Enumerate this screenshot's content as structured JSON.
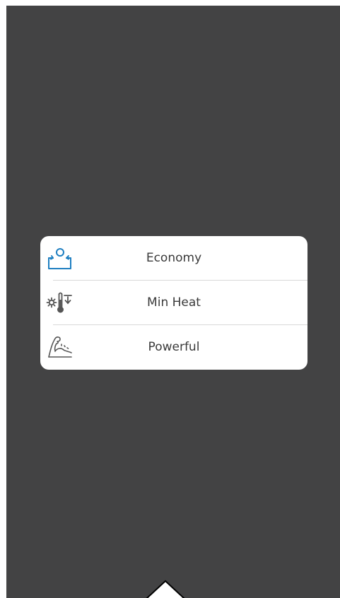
{
  "colors": {
    "overlay_background": "#434344",
    "card_background": "#ffffff",
    "selected_icon": "#1e7fc1",
    "icon_default": "#555555",
    "label_text": "#3a3a3a"
  },
  "mode_menu": {
    "items": [
      {
        "label": "Economy",
        "icon": "economy-icon",
        "selected": true
      },
      {
        "label": "Min Heat",
        "icon": "min-heat-icon",
        "selected": false
      },
      {
        "label": "Powerful",
        "icon": "powerful-icon",
        "selected": false
      }
    ]
  },
  "footer": {
    "handle_icon": "chevron-up-icon"
  }
}
